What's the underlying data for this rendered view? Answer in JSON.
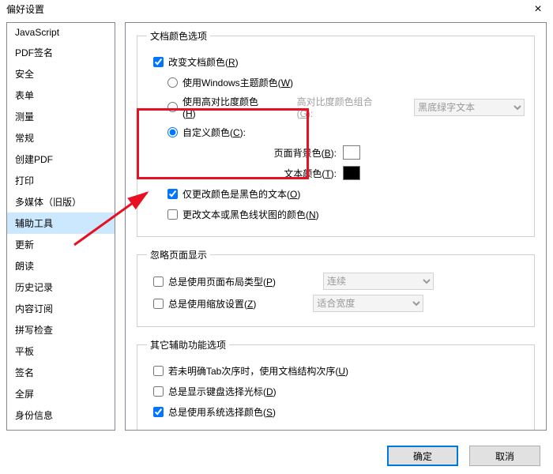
{
  "window": {
    "title": "偏好设置",
    "close": "×"
  },
  "sidebar": {
    "items": [
      {
        "label": "JavaScript"
      },
      {
        "label": "PDF签名"
      },
      {
        "label": "安全"
      },
      {
        "label": "表单"
      },
      {
        "label": "测量"
      },
      {
        "label": "常规"
      },
      {
        "label": "创建PDF"
      },
      {
        "label": "打印"
      },
      {
        "label": "多媒体（旧版）"
      },
      {
        "label": "辅助工具"
      },
      {
        "label": "更新"
      },
      {
        "label": "朗读"
      },
      {
        "label": "历史记录"
      },
      {
        "label": "内容订阅"
      },
      {
        "label": "拼写检查"
      },
      {
        "label": "平板"
      },
      {
        "label": "签名"
      },
      {
        "label": "全屏"
      },
      {
        "label": "身份信息"
      }
    ],
    "selected_index": 9
  },
  "group_doc_color": {
    "legend": "文档颜色选项",
    "change_doc_color": {
      "label": "改变文档颜色(",
      "key": "R",
      "tail": ")"
    },
    "use_win_theme": {
      "label": "使用Windows主题颜色(",
      "key": "W",
      "tail": ")"
    },
    "use_high_contrast": {
      "label": "使用高对比度颜色(",
      "key": "H",
      "tail": ")"
    },
    "hc_combo_label": {
      "label": "高对比度颜色组合(",
      "key": "G",
      "tail": "):"
    },
    "hc_combo_value": "黑底绿字文本",
    "custom_color": {
      "label": "自定义颜色(",
      "key": "C",
      "tail": "):"
    },
    "page_bg": {
      "label": "页面背景色(",
      "key": "B",
      "tail": "):"
    },
    "text_color": {
      "label": "文本颜色(",
      "key": "T",
      "tail": "):"
    },
    "only_black_text": {
      "label": "仅更改颜色是黑色的文本(",
      "key": "O",
      "tail": ")"
    },
    "change_line_art": {
      "label": "更改文本或黑色线状图的颜色(",
      "key": "N",
      "tail": ")"
    }
  },
  "group_ignore_page": {
    "legend": "忽略页面显示",
    "use_layout_type": {
      "label": "总是使用页面布局类型(",
      "key": "P",
      "tail": ")"
    },
    "layout_value": "连续",
    "use_zoom": {
      "label": "总是使用缩放设置(",
      "key": "Z",
      "tail": ")"
    },
    "zoom_value": "适合宽度"
  },
  "group_other": {
    "legend": "其它辅助功能选项",
    "tab_order": {
      "label": "若未明确Tab次序时，使用文档结构次序(",
      "key": "U",
      "tail": ")"
    },
    "kb_cursor": {
      "label": "总是显示键盘选择光标(",
      "key": "D",
      "tail": ")"
    },
    "sys_color": {
      "label": "总是使用系统选择颜色(",
      "key": "S",
      "tail": ")"
    }
  },
  "footer": {
    "ok": "确定",
    "cancel": "取消"
  }
}
